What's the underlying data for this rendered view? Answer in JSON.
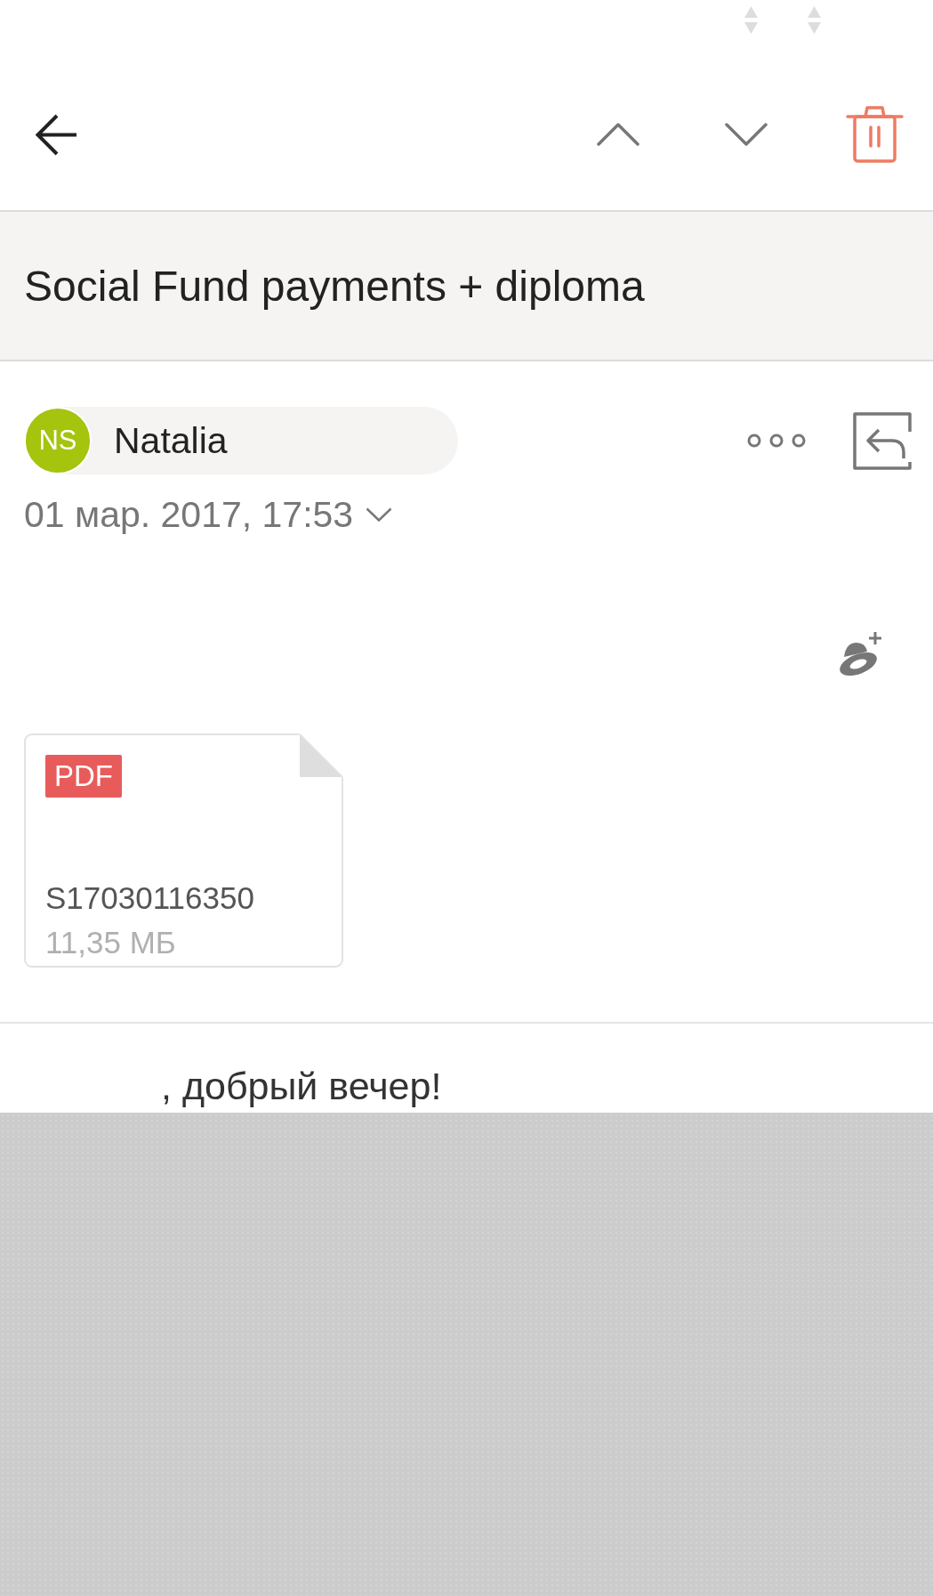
{
  "subject": "Social Fund payments + diploma",
  "sender": {
    "initials": "NS",
    "name": "Natalia"
  },
  "date": "01 мар. 2017, 17:53",
  "attachments": [
    {
      "badge": "PDF",
      "name": "S17030116350",
      "size": "11,35 МБ"
    }
  ],
  "body": {
    "greeting": ", добрый вечер!"
  }
}
